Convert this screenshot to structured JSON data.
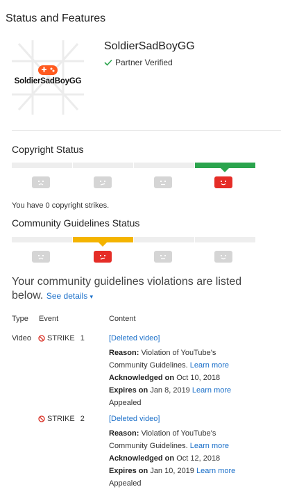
{
  "page_title": "Status and Features",
  "channel": {
    "logo_text": "SoldierSadBoyGG",
    "name": "SoldierSadBoyGG",
    "verified_label": "Partner Verified"
  },
  "copyright": {
    "title": "Copyright Status",
    "active_index": 3,
    "message": "You have 0 copyright strikes."
  },
  "community": {
    "title": "Community Guidelines Status",
    "active_index": 1,
    "message": "Your community guidelines violations are listed below.",
    "see_details": "See details"
  },
  "table": {
    "headers": {
      "type": "Type",
      "event": "Event",
      "content": "Content"
    },
    "rows": [
      {
        "type": "Video",
        "event": "STRIKE",
        "number": "1",
        "content": "[Deleted video]",
        "reason_label": "Reason:",
        "reason_text": "Violation of YouTube's",
        "reason_text2": "Community Guidelines.",
        "learn_more": "Learn more",
        "ack_label": "Acknowledged on",
        "ack_date": "Oct 10, 2018",
        "exp_label": "Expires on",
        "exp_date": "Jan 8, 2019",
        "exp_link": "Learn more",
        "status": "Appealed"
      },
      {
        "type": "",
        "event": "STRIKE",
        "number": "2",
        "content": "[Deleted video]",
        "reason_label": "Reason:",
        "reason_text": "Violation of YouTube's",
        "reason_text2": "Community Guidelines.",
        "learn_more": "Learn more",
        "ack_label": "Acknowledged on",
        "ack_date": "Oct 12, 2018",
        "exp_label": "Expires on",
        "exp_date": "Jan 10, 2019",
        "exp_link": "Learn more",
        "status": "Appealed"
      }
    ]
  },
  "colors": {
    "copyright_active": "#2ba44d",
    "community_active": "#f4b400",
    "face_active": "#e52d27",
    "face_inactive": "#d5d5d5",
    "link": "#1a6fc9"
  }
}
